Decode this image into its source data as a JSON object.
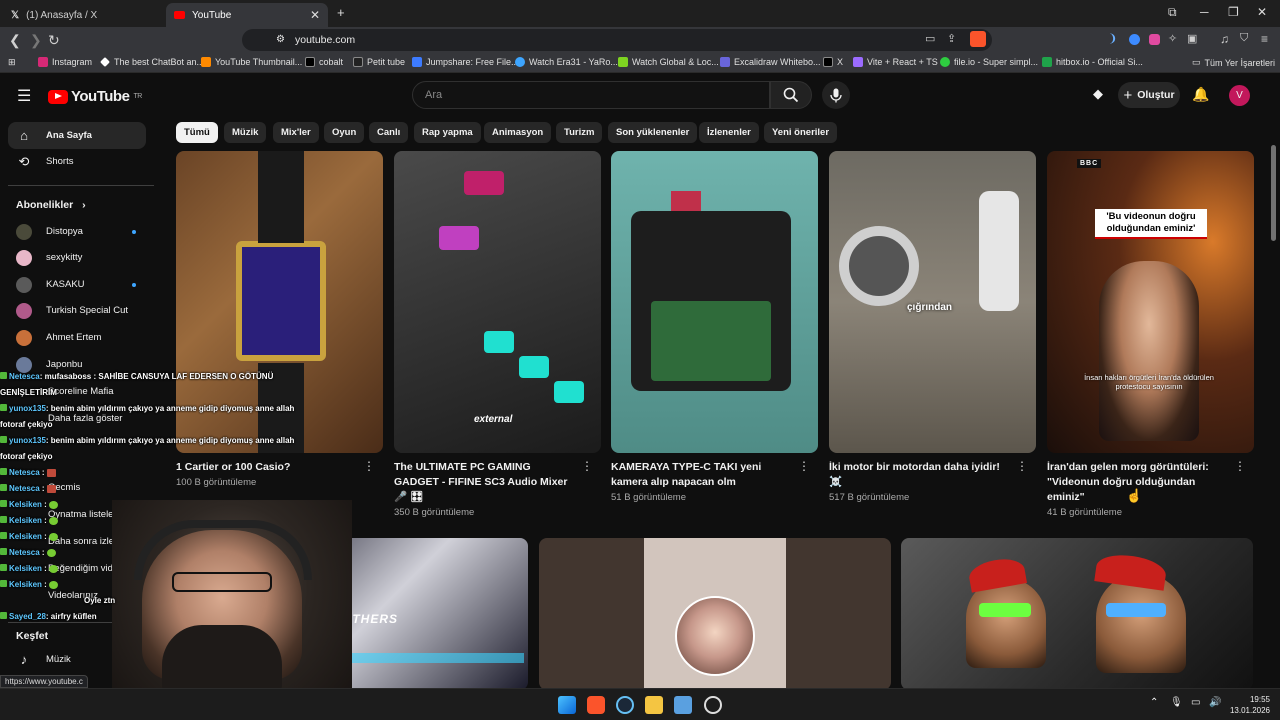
{
  "browser": {
    "tabs": [
      {
        "label": "(1) Anasayfa / X",
        "active": false
      },
      {
        "label": "YouTube",
        "active": true
      }
    ],
    "new_tab": "+",
    "url": "youtube.com",
    "bookmarks": [
      {
        "label": "Instagram",
        "color": "#d62976"
      },
      {
        "label": "The best ChatBot an...",
        "color": "#ffffff"
      },
      {
        "label": "YouTube Thumbnail...",
        "color": "#ff8a00"
      },
      {
        "label": "cobalt",
        "color": "#000000"
      },
      {
        "label": "Petit tube",
        "color": "#222222"
      },
      {
        "label": "Jumpshare: Free File...",
        "color": "#3d7bff"
      },
      {
        "label": "Watch Era31 - YaRo...",
        "color": "#3da5ff"
      },
      {
        "label": "Watch Global & Loc...",
        "color": "#7ed321"
      },
      {
        "label": "Excalidraw Whitebo...",
        "color": "#6965db"
      },
      {
        "label": "X",
        "color": "#000000"
      },
      {
        "label": "Vite + React + TS",
        "color": "#9b6bff"
      },
      {
        "label": "file.io - Super simpl...",
        "color": "#2ecc40"
      },
      {
        "label": "hitbox.io - Official Si...",
        "color": "#1fa34a"
      }
    ],
    "all_bookmarks": "Tüm Yer İşaretleri",
    "status_url": "https://www.youtube.c"
  },
  "masthead": {
    "logo_text": "YouTube",
    "logo_region": "TR",
    "search_placeholder": "Ara",
    "create_label": "Oluştur",
    "avatar_letter": "V"
  },
  "sidebar": {
    "main": [
      {
        "label": "Ana Sayfa",
        "icon": "home-icon",
        "active": true
      },
      {
        "label": "Shorts",
        "icon": "shorts-icon",
        "active": false
      }
    ],
    "subs_header": "Abonelikler",
    "channels": [
      {
        "label": "Distopya",
        "color": "#4a4a3a",
        "dot": true
      },
      {
        "label": "sexykitty",
        "color": "#e8b7c8",
        "dot": false
      },
      {
        "label": "KASAKU",
        "color": "#5a5a5a",
        "dot": true
      },
      {
        "label": "Turkish Special Cut",
        "color": "#b05a8a",
        "dot": false
      },
      {
        "label": "Ahmet Ertem",
        "color": "#c8703a",
        "dot": false
      },
      {
        "label": "Japonbu",
        "color": "#6a7a9a",
        "dot": false
      }
    ],
    "partial_items": [
      "Gecmis",
      "Oynatma listeleri",
      "Daha sonra izle",
      "Beğendiğim videolar",
      "Videolarınız",
      "Daha fazla göster",
      "Scoreline Mafia"
    ],
    "explore_header": "Keşfet",
    "explore": [
      {
        "label": "Müzik",
        "icon": "music-icon"
      }
    ]
  },
  "chips": [
    "Tümü",
    "Müzik",
    "Mix'ler",
    "Oyun",
    "Canlı",
    "Rap yapma",
    "Animasyon",
    "Turizm",
    "Son yüklenenler",
    "İzlenenler",
    "Yeni öneriler"
  ],
  "shorts": [
    {
      "title": "1 Cartier or 100 Casio?",
      "views": "100 B görüntüleme",
      "overlay": ""
    },
    {
      "title": "The ULTIMATE PC GAMING GADGET - FIFINE SC3 Audio Mixer 🎤 🎛",
      "views": "350 B görüntüleme",
      "overlay": "external"
    },
    {
      "title": "KAMERAYA TYPE-C TAKI yeni kamera alıp napacan olm",
      "views": "51 B görüntüleme",
      "overlay": ""
    },
    {
      "title": "İki motor bir motordan daha iyidir! ☠️",
      "views": "517 B görüntüleme",
      "overlay": "çığrından"
    },
    {
      "title": "İran'dan gelen morg görüntüleri: \"Videonun doğru olduğundan eminiz\"",
      "views": "41 B görüntüleme",
      "overlay": "'Bu videonun doğru olduğundan eminiz'",
      "badge": "BBC",
      "caption": "İnsan hakları örgütleri İran'da öldürülen protestocu sayısının"
    }
  ],
  "chat": [
    {
      "user": "Netesca",
      "msg": ": mufasaboss : SAHİBE CANSUYA LAF EDERSEN O GÖTÜNÜ"
    },
    {
      "user": "",
      "msg": "GENİŞLETİRİM"
    },
    {
      "user": "yunox135",
      "msg": ": benim abim yıldırım çakıyo ya anneme gidip diyomuş anne allah"
    },
    {
      "user": "",
      "msg": "fotoraf çekiyo"
    },
    {
      "user": "yunox135",
      "msg": ": benim abim yıldırım çakıyo ya anneme gidip diyomuş anne allah"
    },
    {
      "user": "",
      "msg": "fotoraf çekiyo"
    },
    {
      "user": "Netesca",
      "msg": " :"
    },
    {
      "user": "Netesca",
      "msg": " :"
    },
    {
      "user": "Kelsiken",
      "msg": " :"
    },
    {
      "user": "Kelsiken",
      "msg": " :"
    },
    {
      "user": "Kelsiken",
      "msg": " :"
    },
    {
      "user": "Netesca",
      "msg": " :"
    },
    {
      "user": "Kelsiken",
      "msg": " :"
    },
    {
      "user": "Kelsiken",
      "msg": " :"
    },
    {
      "user": "",
      "msg": "Öyle ztn"
    },
    {
      "user": "Sayed_28",
      "msg": ": airfry küflen"
    }
  ],
  "clock": {
    "time": "19:55",
    "date": "13.01.2026"
  }
}
